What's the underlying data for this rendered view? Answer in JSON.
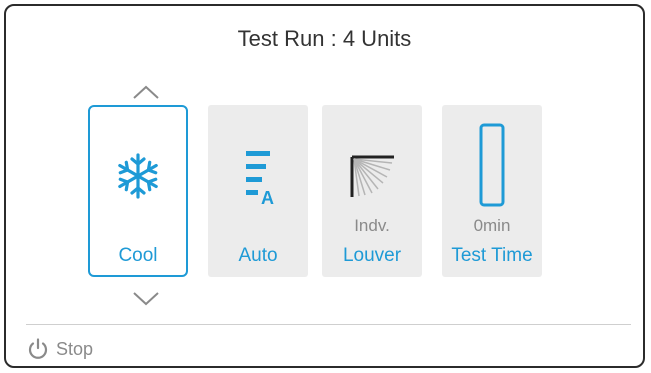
{
  "header": {
    "title": "Test Run : 4 Units"
  },
  "tiles": [
    {
      "label": "Cool",
      "sub": "",
      "icon": "snowflake-icon",
      "selected": true
    },
    {
      "label": "Auto",
      "sub": "",
      "icon": "fan-speed-auto-icon",
      "selected": false
    },
    {
      "label": "Louver",
      "sub": "Indv.",
      "icon": "louver-swing-icon",
      "selected": false
    },
    {
      "label": "Test Time",
      "sub": "0min",
      "icon": "timer-bar-icon",
      "selected": false
    }
  ],
  "nav": {
    "up": "chevron-up-icon",
    "down": "chevron-down-icon"
  },
  "footer": {
    "stop_label": "Stop",
    "icon": "power-icon"
  },
  "colors": {
    "accent": "#1e9ad6",
    "tile_bg": "#ececec",
    "text_muted": "#8a8a8a",
    "border": "#2b2b2b"
  }
}
